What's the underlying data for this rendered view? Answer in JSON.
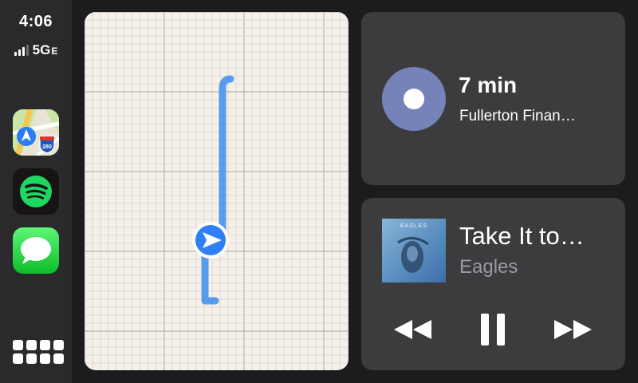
{
  "status": {
    "time": "4:06",
    "network": "5G",
    "network_suffix": "E"
  },
  "sidebar": {
    "apps": [
      {
        "name": "Maps",
        "icon": "maps-icon",
        "badge": "280"
      },
      {
        "name": "Spotify",
        "icon": "spotify-icon"
      },
      {
        "name": "Messages",
        "icon": "messages-icon"
      }
    ],
    "launcher_icon": "grid-icon"
  },
  "map": {
    "route_color": "#3b8df0",
    "position_icon": "location-arrow-icon"
  },
  "navigation": {
    "eta": "7 min",
    "destination": "Fullerton Finan…",
    "accent": "#7683b9"
  },
  "now_playing": {
    "album_title": "EAGLES",
    "title": "Take It to…",
    "artist": "Eagles",
    "controls": [
      "rewind-icon",
      "pause-icon",
      "fast-forward-icon"
    ]
  }
}
